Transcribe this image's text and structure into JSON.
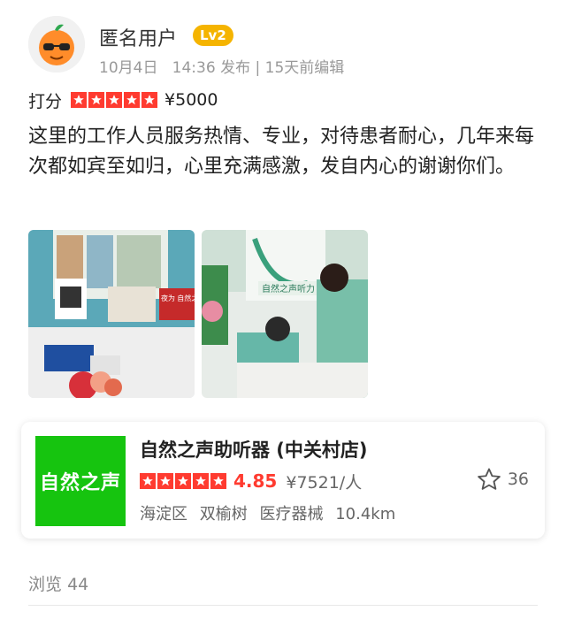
{
  "user": {
    "name": "匿名用户",
    "level": "Lv2",
    "date": "10月4日",
    "time": "14:36 发布",
    "separator": "|",
    "edited": "15天前编辑"
  },
  "rating": {
    "label": "打分",
    "stars": 5,
    "price": "¥5000"
  },
  "review_text": "这里的工作人员服务热情、专业，对待患者耐心，几年来每次都如宾至如归，心里充满感激，发自内心的谢谢你们。",
  "photos": {
    "photo1_overlay": "夜为 自然之声 耳鼻喉代言",
    "photo2_sign": "自然之声听力"
  },
  "shop": {
    "logo_text": "自然之声",
    "name": "自然之声助听器 (中关村店)",
    "stars": 5,
    "score": "4.85",
    "avg_price": "¥7521/人",
    "district": "海淀区",
    "area": "双榆树",
    "category": "医疗器械",
    "distance": "10.4km",
    "favorites": "36"
  },
  "views_label": "浏览",
  "views_count": "44",
  "colors": {
    "star_red": "#ff3b30",
    "badge_gold": "#f5b400",
    "shop_green": "#16c40f"
  }
}
